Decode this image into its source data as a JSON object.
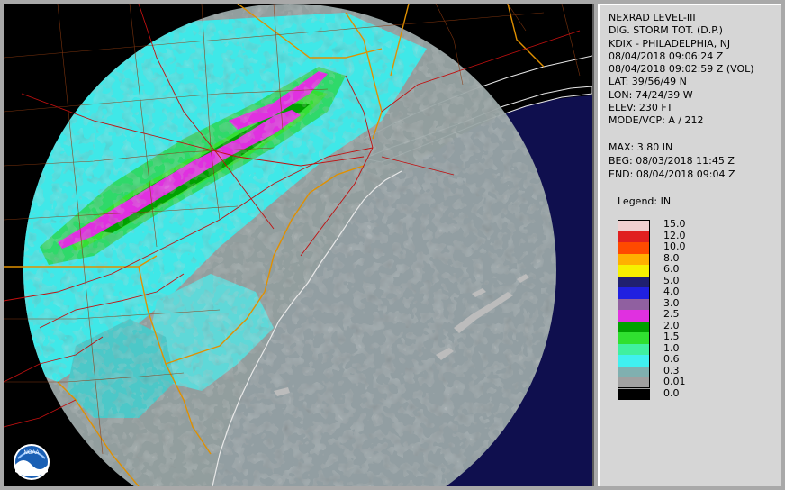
{
  "info": {
    "product": "NEXRAD LEVEL-III",
    "type": "DIG. STORM TOT. (D.P.)",
    "station": "KDIX - PHILADELPHIA, NJ",
    "time1": "08/04/2018 09:06:24 Z",
    "time2": "08/04/2018 09:02:59 Z (VOL)",
    "lat": "LAT: 39/56/49 N",
    "lon": "LON: 74/24/39 W",
    "elev": "ELEV: 230 FT",
    "mode": "MODE/VCP: A / 212"
  },
  "stats": {
    "max": "MAX: 3.80 IN",
    "beg": "BEG: 08/03/2018 11:45 Z",
    "end": "END: 08/04/2018 09:04 Z"
  },
  "legend": {
    "title": "Legend: IN",
    "entries": [
      {
        "label": "15.0",
        "color": "#f0d0d0"
      },
      {
        "label": "12.0",
        "color": "#e02020"
      },
      {
        "label": "10.0",
        "color": "#ff4a00"
      },
      {
        "label": "8.0",
        "color": "#ffb000"
      },
      {
        "label": "6.0",
        "color": "#f6f000"
      },
      {
        "label": "5.0",
        "color": "#202070"
      },
      {
        "label": "4.0",
        "color": "#2020e0"
      },
      {
        "label": "3.0",
        "color": "#9060a0"
      },
      {
        "label": "2.5",
        "color": "#e030e0"
      },
      {
        "label": "2.0",
        "color": "#00a000"
      },
      {
        "label": "1.5",
        "color": "#30e030"
      },
      {
        "label": "1.0",
        "color": "#40f0a0"
      },
      {
        "label": "0.6",
        "color": "#40f0f0"
      },
      {
        "label": "0.3",
        "color": "#80b0b0"
      },
      {
        "label": "0.01",
        "color": "#a0a0a0"
      },
      {
        "label": "0.0",
        "color": "#000000"
      }
    ]
  },
  "map": {
    "logo_text": "NOAA",
    "ocean_color": "#0f0f4e",
    "land_color": "#000000",
    "coast_color": "#e8e8e8",
    "state_border_color": "#e09000",
    "road_color": "#c01010",
    "county_color": "#8b3a10"
  }
}
